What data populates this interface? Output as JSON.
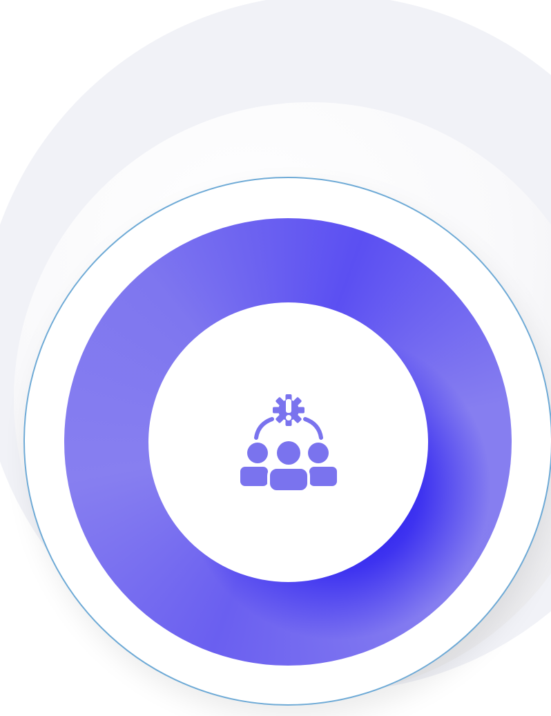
{
  "graphic": {
    "icon": "team-alert-gear-icon",
    "icon_color": "#7a73ee",
    "ring_outline_color": "#6eaad6",
    "gradient_colors": [
      "#5b4ff2",
      "#877ff0",
      "#1208e6"
    ],
    "background_color": "#f1f2f7"
  }
}
